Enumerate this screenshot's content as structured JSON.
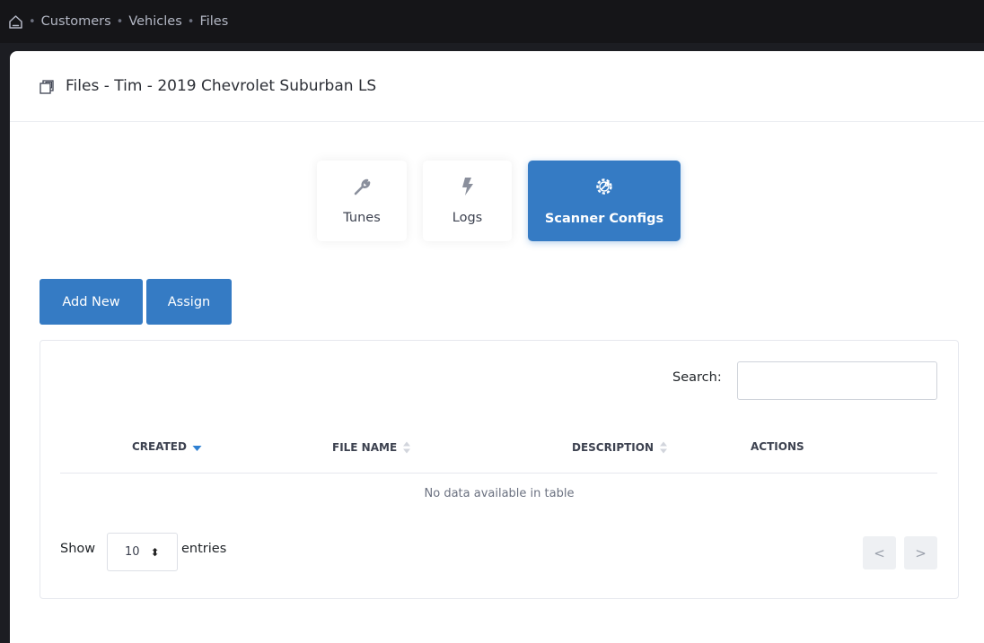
{
  "breadcrumb": {
    "items": [
      "Customers",
      "Vehicles",
      "Files"
    ],
    "separator": "•"
  },
  "page": {
    "title": "Files - Tim - 2019 Chevrolet Suburban LS"
  },
  "tabs": [
    {
      "label": "Tunes",
      "icon": "wrench-icon",
      "active": false
    },
    {
      "label": "Logs",
      "icon": "lightning-icon",
      "active": false
    },
    {
      "label": "Scanner Configs",
      "icon": "gear-wrench-icon",
      "active": true
    }
  ],
  "toolbar": {
    "add_label": "Add New",
    "assign_label": "Assign"
  },
  "table": {
    "search_label": "Search:",
    "search_value": "",
    "columns": [
      "CREATED",
      "FILE NAME",
      "DESCRIPTION",
      "ACTIONS"
    ],
    "sorted_column": "CREATED",
    "empty_message": "No data available in table",
    "length": {
      "show_label": "Show",
      "value": "10",
      "entries_label": "entries"
    },
    "pagination": {
      "prev": "<",
      "next": ">"
    }
  },
  "colors": {
    "accent": "#357bc4",
    "topbar": "#151518",
    "sidebar": "#1c1d22"
  }
}
